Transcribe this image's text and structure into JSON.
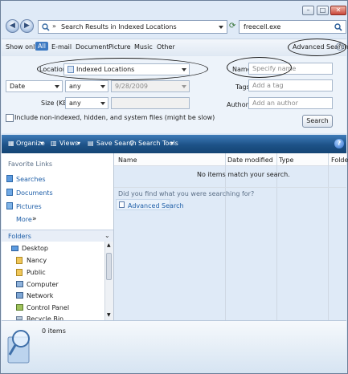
{
  "window": {
    "address": "Search Results in Indexed Locations",
    "search_query": "freecell.exe",
    "caption_buttons": [
      "minimize",
      "maximize",
      "close"
    ]
  },
  "show_only": {
    "label": "Show only:",
    "filters": [
      "All",
      "E-mail",
      "Document",
      "Picture",
      "Music",
      "Other"
    ],
    "selected": "All",
    "advanced_search": "Advanced Search"
  },
  "advanced": {
    "location_label": "Location",
    "location_value": "Indexed Locations",
    "date_field": "Date",
    "date_op": "any",
    "date_value": "9/28/2009",
    "size_label": "Size (KB)",
    "size_op": "any",
    "include_label": "Include non-indexed, hidden, and system files (might be slow)",
    "name_label": "Name",
    "name_placeholder": "Specify name",
    "tags_label": "Tags",
    "tags_placeholder": "Add a tag",
    "authors_label": "Authors",
    "authors_placeholder": "Add an author",
    "search_button": "Search"
  },
  "toolbar": {
    "organize": "Organize",
    "views": "Views",
    "save_search": "Save Search",
    "search_tools": "Search Tools"
  },
  "nav": {
    "favorite_links_header": "Favorite Links",
    "links": [
      "Searches",
      "Documents",
      "Pictures"
    ],
    "more": "More",
    "folders_header": "Folders",
    "tree": [
      "Desktop",
      "Nancy",
      "Public",
      "Computer",
      "Network",
      "Control Panel",
      "Recycle Bin"
    ]
  },
  "list": {
    "columns": [
      "Name",
      "Date modified",
      "Type",
      "Folde"
    ],
    "empty_message": "No items match your search.",
    "prompt": "Did you find what you were searching for?",
    "advanced_link": "Advanced Search"
  },
  "details": {
    "count": "0 items"
  },
  "colors": {
    "toolbar": "#1d5288",
    "link": "#1f5fa8",
    "selected_filter": "#3c79c2"
  }
}
